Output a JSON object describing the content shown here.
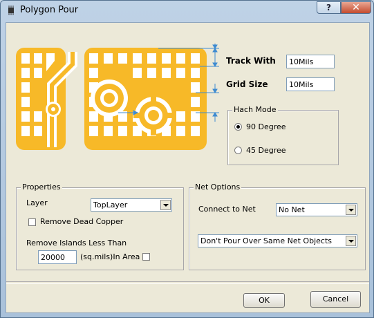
{
  "window": {
    "title": "Polygon Pour",
    "help_glyph": "?",
    "close_glyph": "✕"
  },
  "colors": {
    "copper": "#f7b928",
    "arrow": "#3e8bd1"
  },
  "preview_icon": "polygon-pour-preview-icon",
  "track": {
    "label": "Track With",
    "value": "10Mils"
  },
  "grid": {
    "label": "Grid Size",
    "value": "10Mils"
  },
  "hatch_mode": {
    "title": "Hach Mode",
    "options": [
      {
        "label": "90 Degree",
        "checked": true
      },
      {
        "label": "45 Degree",
        "checked": false
      }
    ]
  },
  "properties": {
    "title": "Properties",
    "layer_label": "Layer",
    "layer_value": "TopLayer",
    "remove_dead_copper_label": "Remove Dead Copper",
    "remove_dead_copper_checked": false,
    "remove_islands_label": "Remove Islands Less Than",
    "islands_value": "20000",
    "islands_unit_label": "(sq.mils)In Area",
    "in_area_checked": false
  },
  "net_options": {
    "title": "Net Options",
    "connect_label": "Connect to Net",
    "connect_value": "No Net",
    "pour_option": "Don't Pour Over Same Net Objects"
  },
  "buttons": {
    "ok": "OK",
    "cancel": "Cancel"
  }
}
